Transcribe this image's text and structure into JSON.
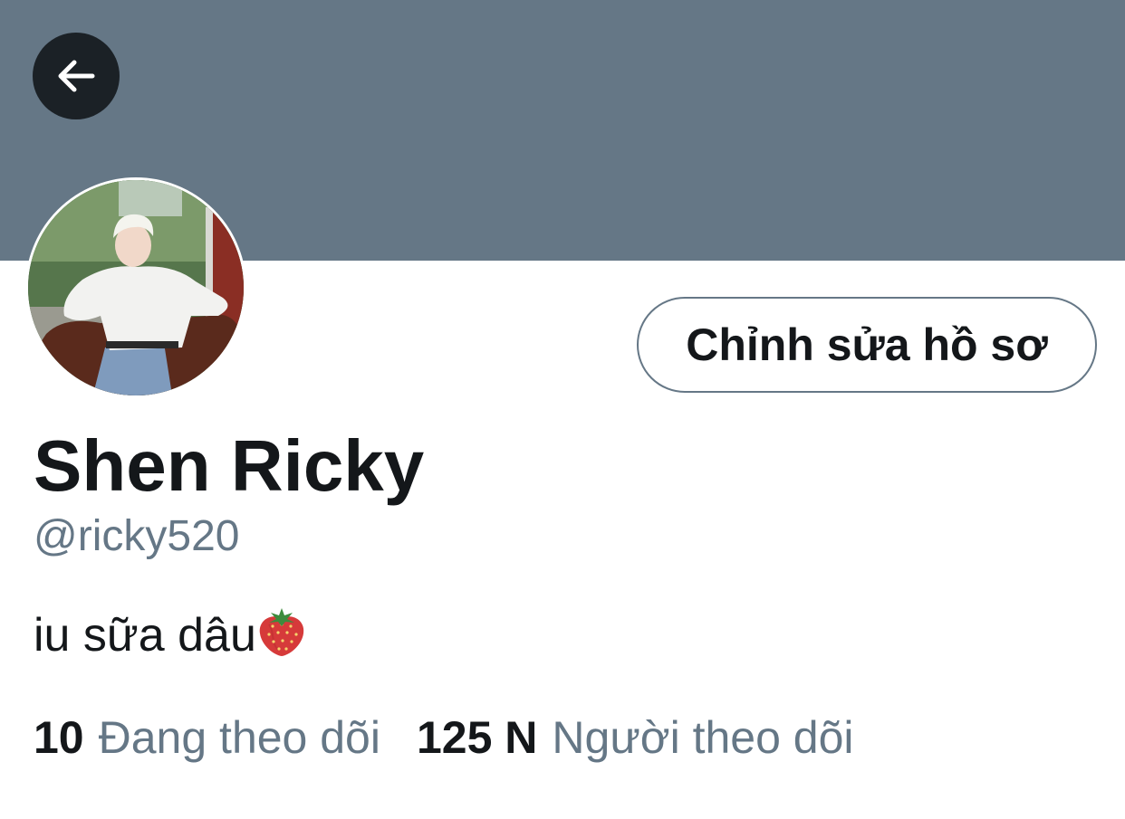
{
  "profile": {
    "display_name": "Shen Ricky",
    "handle": "@ricky520",
    "bio": "iu sữa dâu",
    "bio_emoji": "strawberry-emoji",
    "edit_profile_label": "Chỉnh sửa hồ sơ"
  },
  "stats": {
    "following_count": "10",
    "following_label": "Đang theo dõi",
    "followers_count": "125 N",
    "followers_label": "Người theo dõi"
  },
  "icons": {
    "back": "arrow-left-icon"
  },
  "colors": {
    "banner": "#657786",
    "secondary_text": "#657786",
    "primary_text": "#14171a",
    "back_button_bg": "#1b2126"
  }
}
